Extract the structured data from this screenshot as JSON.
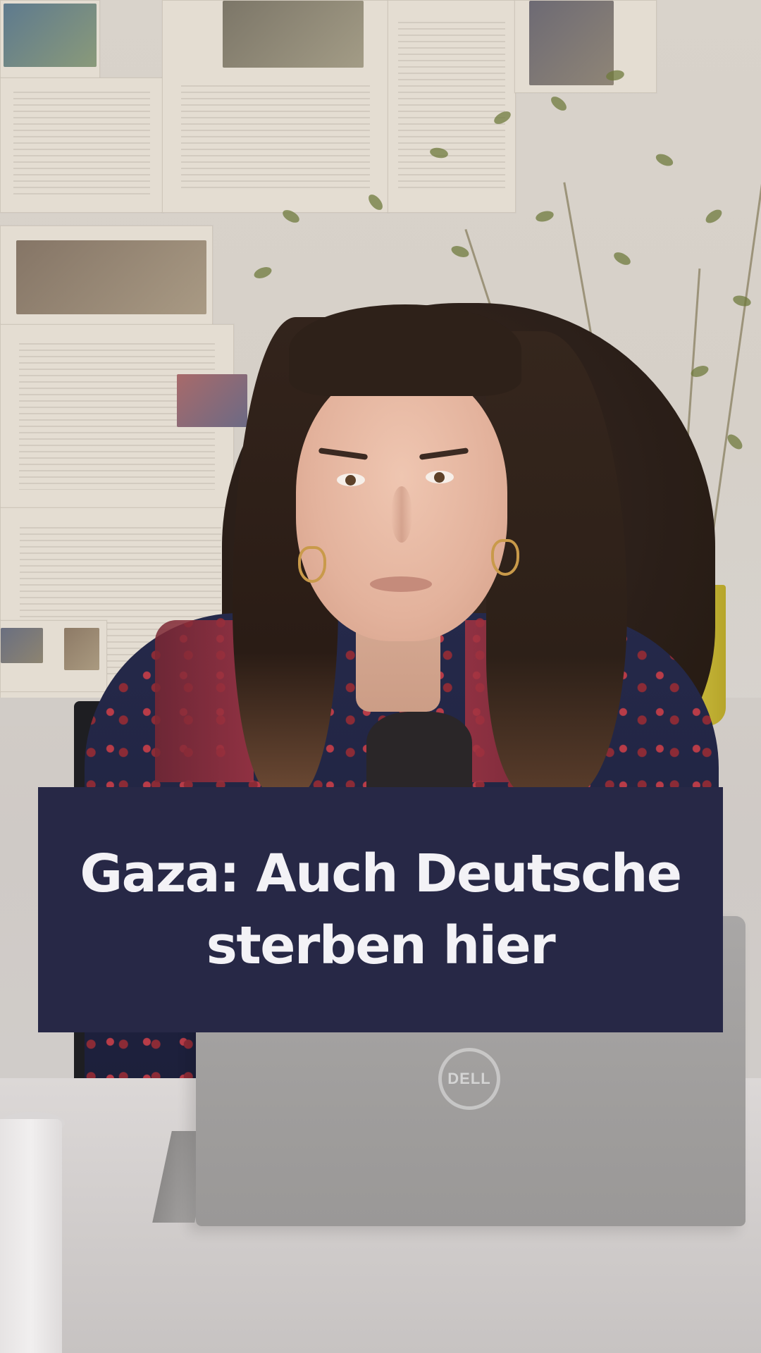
{
  "overlay": {
    "title_line1": "Gaza: Auch Deutsche",
    "title_line2": "sterben hier",
    "card_color": "#272846",
    "text_color": "#f3f2f6"
  },
  "scene": {
    "laptop_brand": "DELL",
    "icons": [
      "dell-logo-icon"
    ]
  }
}
